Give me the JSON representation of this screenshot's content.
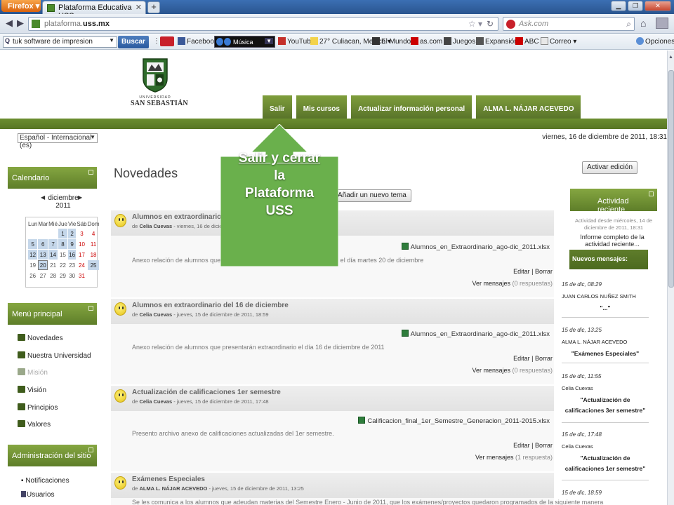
{
  "browser": {
    "app_button": "Firefox",
    "tab_title": "Plataforma Educativa USS",
    "url_prefix": "plataforma.",
    "url_domain": "uss.mx",
    "search_placeholder": "Ask.com",
    "toolbar_search_value": "tuk software de impresion",
    "toolbar_search_button": "Buscar",
    "musica_label": "Música",
    "opciones_label": "Opciones",
    "bookmarks": [
      "Facebook",
      "YouTube",
      "27° Culiacan, Mexico",
      "El Mundo",
      "as.com",
      "Juegos",
      "Expansión",
      "ABC",
      "Correo"
    ]
  },
  "site": {
    "logo_small": "UNIVERSIDAD",
    "logo_name": "SAN SEBASTIÁN",
    "nav_tabs": [
      "Salir",
      "Mis cursos",
      "Actualizar información personal",
      "ALMA L. NÁJAR ACEVEDO"
    ],
    "language": "Español - Internacional (es)",
    "date_now": "viernes, 16 de diciembre de 2011, 18:31",
    "main_title": "Novedades",
    "new_topic_label": "Añadir un nuevo tema",
    "edit_button": "Activar edición"
  },
  "calendar": {
    "title": "Calendario",
    "month": "diciembre",
    "year": "2011",
    "weekdays": [
      "Lun",
      "Mar",
      "Mié",
      "Jue",
      "Vie",
      "Sáb",
      "Dom"
    ],
    "weeks": [
      [
        "",
        "",
        "",
        "1",
        "2",
        "3",
        "4"
      ],
      [
        "5",
        "6",
        "7",
        "8",
        "9",
        "10",
        "11"
      ],
      [
        "12",
        "13",
        "14",
        "15",
        "16",
        "17",
        "18"
      ],
      [
        "19",
        "20",
        "21",
        "22",
        "23",
        "24",
        "25"
      ],
      [
        "26",
        "27",
        "28",
        "29",
        "30",
        "31",
        ""
      ]
    ],
    "event_days": [
      "1",
      "2",
      "5",
      "6",
      "7",
      "8",
      "9",
      "12",
      "13",
      "14",
      "16",
      "20",
      "25"
    ],
    "today": "20"
  },
  "menu": {
    "title": "Menú principal",
    "items": [
      "Novedades",
      "Nuestra Universidad",
      "Misión",
      "Visión",
      "Principios",
      "Valores"
    ]
  },
  "admin": {
    "title": "Administración del sitio",
    "items": [
      "Notificaciones",
      "Usuarios"
    ]
  },
  "posts": [
    {
      "title": "Alumnos en extraordinario del 20 de diciembre",
      "author": "Celia Cuevas",
      "date": " - viernes, 16 de diciembre de 2011, 13:36",
      "attachment": "Alumnos_en_Extraordinario_ago-dic_2011.xlsx",
      "text": "Anexo relación de alumnos que deberán presentar examen extraordinario el día martes 20 de diciembre",
      "replies": "(0 respuestas)"
    },
    {
      "title": "Alumnos en extraordinario del 16 de diciembre",
      "author": "Celia Cuevas",
      "date": " - jueves, 15 de diciembre de 2011, 18:59",
      "attachment": "Alumnos_en_Extraordinario_ago-dic_2011.xlsx",
      "text": "Anexo relación de alumnos que presentarán extraordinario el día 16 de diciembre de 2011",
      "replies": "(0 respuestas)"
    },
    {
      "title": "Actualización de calificaciones 1er semestre",
      "author": "Celia Cuevas",
      "date": " - jueves, 15 de diciembre de 2011, 17:48",
      "attachment": "Calificacion_final_1er_Semestre_Generacion_2011-2015.xlsx",
      "text": "Presento archivo anexo de calificaciones actualizadas del 1er semestre.",
      "replies": "(1 respuesta)"
    },
    {
      "title": "Exámenes Especiales",
      "author": "ALMA L. NÁJAR ACEVEDO",
      "date": " - jueves, 15 de diciembre de 2011, 13:25",
      "text": "Se les comunica a los alumnos que adeudan materias del Semestre Enero - Junio de 2011, que los exámenes/proyectos quedaron programados de la siguiente manera"
    }
  ],
  "post_labels": {
    "by": "de ",
    "edit": "Editar",
    "delete": "Borrar",
    "separator": " | ",
    "view": "Ver mensajes "
  },
  "activity": {
    "title": "Actividad reciente",
    "since": "Actividad desde miércoles, 14 de diciembre de 2011, 18:31",
    "report": "Informe completo de la actividad reciente...",
    "new_messages": "Nuevos mensajes:",
    "items": [
      {
        "date": "15 de dic, 08:29",
        "user": "JUAN CARLOS NUÑEZ SMITH",
        "subject": "\"...\""
      },
      {
        "date": "15 de dic, 13:25",
        "user": "ALMA L. NÁJAR ACEVEDO",
        "subject": "\"Exámenes Especiales\""
      },
      {
        "date": "15 de dic, 11:55",
        "user": "Celia Cuevas",
        "subject": "\"Actualización de calificaciones 3er semestre\""
      },
      {
        "date": "15 de dic, 17:48",
        "user": "Celia Cuevas",
        "subject": "\"Actualización de calificaciones 1er semestre\""
      },
      {
        "date": "15 de dic, 18:59",
        "user": "",
        "subject": ""
      }
    ]
  },
  "callout": {
    "line1": "Salir y cerrar",
    "line2": "la",
    "line3": "Plataforma",
    "line4": "USS",
    "color": "#6ab04c"
  },
  "colors": {
    "site_green": "#6b8e2f",
    "browser_blue": "#2a558f"
  }
}
